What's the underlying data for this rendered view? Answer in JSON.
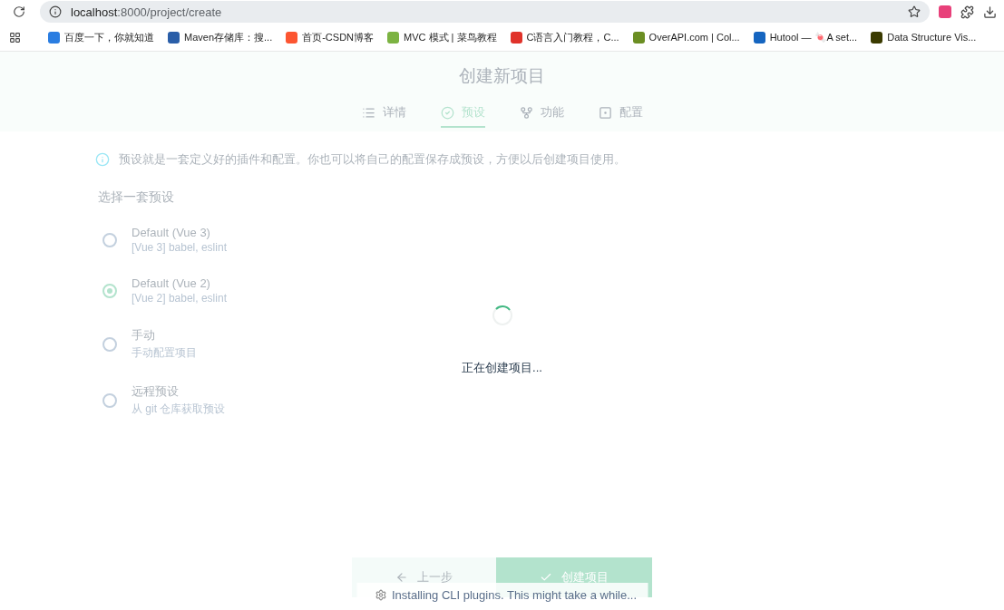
{
  "browser": {
    "url_host": "localhost",
    "url_rest": ":8000/project/create",
    "bookmarks": [
      {
        "label": "百度一下，你就知道",
        "color": "#2a7de1"
      },
      {
        "label": "Maven存储库：搜...",
        "color": "#2a5ea8"
      },
      {
        "label": "首页-CSDN博客",
        "color": "#fc5531"
      },
      {
        "label": "MVC 模式 | 菜鸟教程",
        "color": "#7cb342"
      },
      {
        "label": "C语言入门教程，C...",
        "color": "#e0322a"
      },
      {
        "label": "OverAPI.com | Col...",
        "color": "#6b8e23"
      },
      {
        "label": "Hutool — 🍬A set...",
        "color": "#1565c0"
      },
      {
        "label": "Data Structure Vis...",
        "color": "#3a3a00"
      }
    ]
  },
  "page": {
    "title": "创建新项目",
    "tabs": [
      {
        "label": "详情",
        "kind": "list",
        "selected": false
      },
      {
        "label": "预设",
        "kind": "check",
        "selected": true
      },
      {
        "label": "功能",
        "kind": "fork",
        "selected": false
      },
      {
        "label": "配置",
        "kind": "config",
        "selected": false
      }
    ],
    "info": "预设就是一套定义好的插件和配置。你也可以将自己的配置保存成预设，方便以后创建项目使用。",
    "section_label": "选择一套预设",
    "presets": [
      {
        "name": "Default (Vue 3)",
        "description": "[Vue 3] babel, eslint",
        "selected": false
      },
      {
        "name": "Default (Vue 2)",
        "description": "[Vue 2] babel, eslint",
        "selected": true
      },
      {
        "name": "手动",
        "description": "手动配置项目",
        "selected": false
      },
      {
        "name": "远程预设",
        "description": "从 git 仓库获取预设",
        "selected": false
      }
    ],
    "buttons": [
      {
        "label": "上一步",
        "kind": "back"
      },
      {
        "label": "创建项目",
        "kind": "primary"
      }
    ]
  },
  "overlay": {
    "message": "正在创建项目...",
    "status": "Installing CLI plugins. This might take a while..."
  }
}
